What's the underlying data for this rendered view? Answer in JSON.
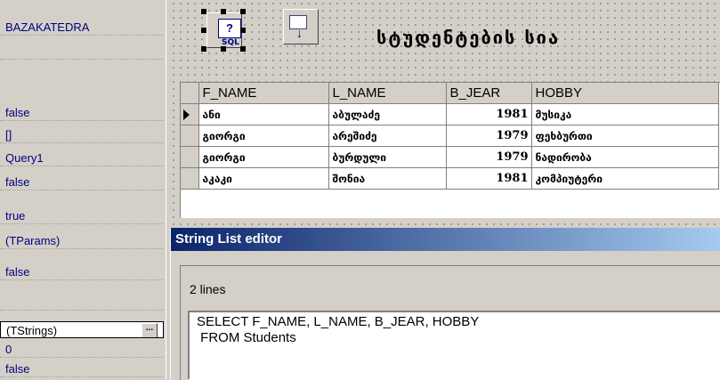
{
  "inspector": {
    "rows": [
      "BAZAKATEDRA",
      "",
      "false",
      "[]",
      "Query1",
      "false",
      "true",
      "(TParams)",
      "false",
      "",
      "(TStrings)",
      "0",
      "false"
    ],
    "selected_index": 10,
    "ellipsis": "..."
  },
  "form": {
    "title": "სტუდენტების სია",
    "sql_icon_label": "SQL",
    "sql_icon_glyph": "?",
    "grid": {
      "columns": [
        "F_NAME",
        "L_NAME",
        "B_JEAR",
        "HOBBY"
      ],
      "rows": [
        [
          "ანი",
          "აბულაძე",
          "1981",
          "მუსიკა"
        ],
        [
          "გიორგი",
          "არეშიძე",
          "1979",
          "ფეხბურთი"
        ],
        [
          "გიორგი",
          "ბურდული",
          "1979",
          "ნადირობა"
        ],
        [
          "აკაკი",
          "შონია",
          "1981",
          "კომპიუტერი"
        ]
      ],
      "current_row": 0
    }
  },
  "editor": {
    "title": "String List editor",
    "line_count": "2 lines",
    "lines": [
      "SELECT F_NAME, L_NAME, B_JEAR, HOBBY",
      " FROM Students"
    ]
  },
  "colors": {
    "title_bar_start": "#0a246a",
    "title_bar_end": "#a6caf0",
    "inspector_text": "#000080"
  }
}
